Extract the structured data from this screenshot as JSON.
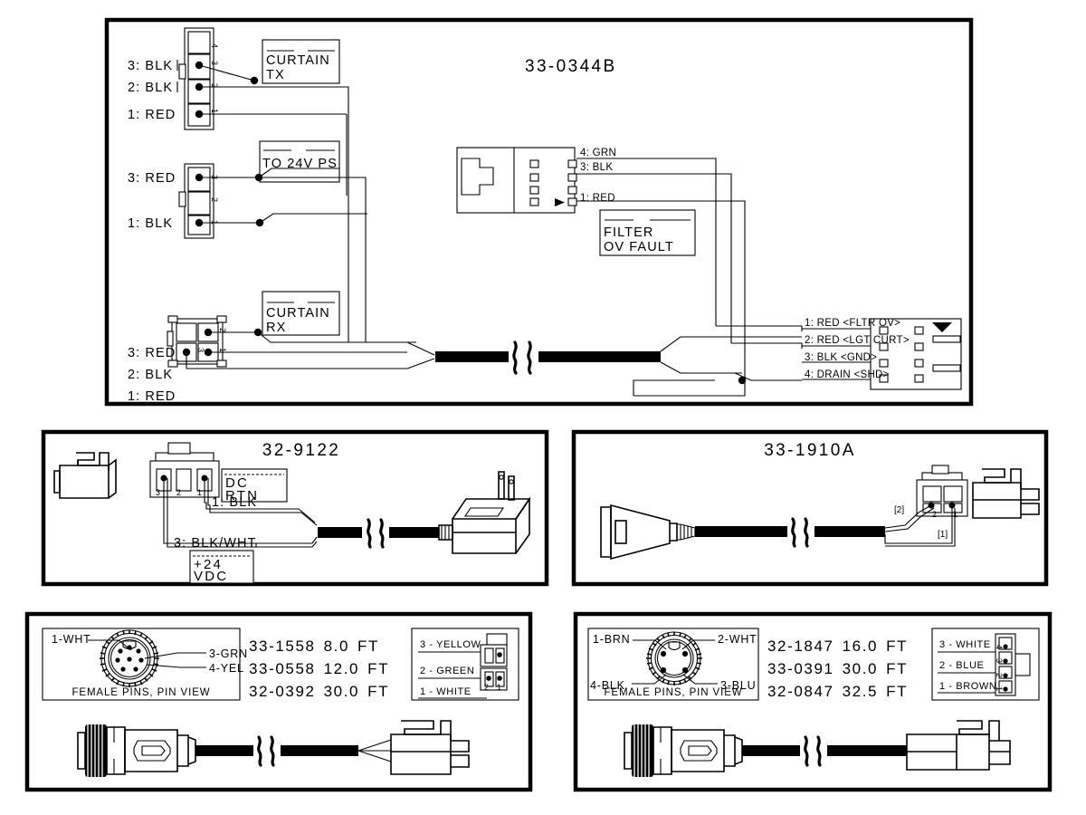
{
  "document": {
    "type": "cable-assembly-wiring-diagram",
    "sheet_background": "#ffffff",
    "line_color": "#000000"
  },
  "panels": [
    {
      "id": "panel-33-0344b",
      "title": "33-0344B",
      "left_connectors": [
        {
          "name": "curtain-tx-connector",
          "positions": 4,
          "pin_numbers": [
            "4",
            "3",
            "2",
            "1"
          ],
          "labels": [
            {
              "pin": "3",
              "text": "3:  BLK"
            },
            {
              "pin": "2",
              "text": "2:  BLK"
            },
            {
              "pin": "1",
              "text": "1:  RED"
            }
          ],
          "callout": "CURTAIN\nTX",
          "callout_line1": "CURTAIN",
          "callout_line2": "TX"
        },
        {
          "name": "power-supply-connector",
          "positions": 3,
          "pin_numbers": [
            "3",
            "2",
            "1"
          ],
          "labels": [
            {
              "pin": "3",
              "text": "3:  RED"
            },
            {
              "pin": "1",
              "text": "1:  BLK"
            }
          ],
          "callout_line1": "TO 24V PS",
          "callout_line2": ""
        },
        {
          "name": "curtain-rx-connector",
          "positions": 4,
          "pin_numbers": [
            "2",
            "1",
            "3",
            "4"
          ],
          "labels": [
            {
              "pin": "3",
              "text": "3:  RED"
            },
            {
              "pin": "2",
              "text": "2:  BLK"
            },
            {
              "pin": "1",
              "text": "1:  RED"
            }
          ],
          "callout_line1": "CURTAIN",
          "callout_line2": "RX"
        }
      ],
      "center_connector": {
        "name": "filter-ov-fault-connector",
        "wires": [
          "4: GRN",
          "3: BLK",
          "1: RED"
        ],
        "callout_line1": "FILTER",
        "callout_line2": "OV FAULT"
      },
      "right_connector": {
        "name": "output-connector",
        "wires": [
          "1: RED <FLTR OV>",
          "2: RED <LGT CURT>",
          "3: BLK <GND>",
          "4: DRAIN <SHD>"
        ]
      }
    },
    {
      "id": "panel-32-9122",
      "title": "32-9122",
      "connector_pin_numbers": [
        "3",
        "2",
        "1"
      ],
      "tag_dc_rtn_line1": "DC",
      "tag_dc_rtn_line2": "RTN",
      "tag_24vdc_line1": "+24",
      "tag_24vdc_line2": "VDC",
      "wire_labels": [
        "1:  BLK",
        "3:  BLK/WHT"
      ]
    },
    {
      "id": "panel-33-1910a",
      "title": "33-1910A",
      "wire_index_labels": [
        "[2]",
        "[1]"
      ],
      "connector_pin_numbers": [
        "2",
        "1"
      ]
    },
    {
      "id": "panel-33-1558",
      "title": "",
      "pin_view_caption": "FEMALE PINS, PIN VIEW",
      "pin_callouts": [
        {
          "name": "pin-1",
          "text": "1-WHT"
        },
        {
          "name": "pin-3",
          "text": "3-GRN"
        },
        {
          "name": "pin-4",
          "text": "4-YEL"
        }
      ],
      "part_numbers": [
        {
          "pn": "33-1558",
          "length": "8.0",
          "unit": "FT"
        },
        {
          "pn": "33-0558",
          "length": "12.0",
          "unit": "FT"
        },
        {
          "pn": "32-0392",
          "length": "30.0",
          "unit": "FT"
        }
      ],
      "termination_table": [
        {
          "pin": "3",
          "color": "YELLOW",
          "text": "3  -  YELLOW"
        },
        {
          "pin": "2",
          "color": "GREEN",
          "text": "2  -  GREEN"
        },
        {
          "pin": "1",
          "color": "WHITE",
          "text": "1  -  WHITE"
        }
      ],
      "termination_pin_numbers": [
        "2",
        "1"
      ]
    },
    {
      "id": "panel-32-1847",
      "title": "",
      "pin_view_caption": "FEMALE PINS, PIN VIEW",
      "pin_callouts": [
        {
          "name": "pin-1",
          "text": "1-BRN"
        },
        {
          "name": "pin-2",
          "text": "2-WHT"
        },
        {
          "name": "pin-4",
          "text": "4-BLK"
        },
        {
          "name": "pin-3",
          "text": "3-BLU"
        }
      ],
      "part_numbers": [
        {
          "pn": "32-1847",
          "length": "16.0",
          "unit": "FT"
        },
        {
          "pn": "33-0391",
          "length": "30.0",
          "unit": "FT"
        },
        {
          "pn": "32-0847",
          "length": "32.5",
          "unit": "FT"
        }
      ],
      "termination_table": [
        {
          "pin": "3",
          "color": "WHITE",
          "text": "3  -  WHITE"
        },
        {
          "pin": "2",
          "color": "BLUE",
          "text": "2  -  BLUE"
        },
        {
          "pin": "1",
          "color": "BROWN",
          "text": "1  -  BROWN"
        }
      ],
      "termination_pin_numbers": [
        "4",
        "3",
        "2",
        "1"
      ]
    }
  ]
}
